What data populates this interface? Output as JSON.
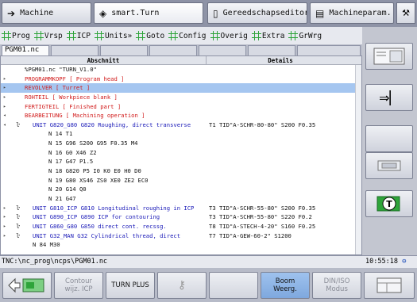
{
  "modes": [
    {
      "label": "Machine",
      "icon": "arrow-right-icon"
    },
    {
      "label": "smart.Turn",
      "icon": "diamond-arrow-icon",
      "active": true
    },
    {
      "label": "Gereedschapseditor",
      "icon": "tool-editor-icon"
    },
    {
      "label": "Machineparam.",
      "icon": "machine-param-icon"
    }
  ],
  "menu": [
    "Prog",
    "Vrsp",
    "ICP",
    "Units»",
    "Goto",
    "Config",
    "Overig",
    "Extra",
    "GrWrg"
  ],
  "file_tab": "PGM01.nc",
  "table": {
    "col_section": "Abschnitt",
    "col_details": "Details",
    "rows": [
      {
        "text": "%PGM01.nc  \"TURN_V1.0\"",
        "color": "black",
        "indent": 30
      },
      {
        "text": "PROGRAMMKOPF  [ Program head ]",
        "color": "red",
        "indent": 30,
        "exp": "▸"
      },
      {
        "text": "REVOLVER  [ Turret ]",
        "color": "red",
        "indent": 30,
        "exp": "▸",
        "sel": true
      },
      {
        "text": "ROHTEIL  [ Workpiece blank ]",
        "color": "red",
        "indent": 30,
        "exp": "▸"
      },
      {
        "text": "FERTIGTEIL  [ Finished part ]",
        "color": "red",
        "indent": 30,
        "exp": "▸"
      },
      {
        "text": "BEARBEITUNG  [ Machining operation ]",
        "color": "red",
        "indent": 30,
        "exp": "◂"
      },
      {
        "text": "UNIT G820_G80  G820 Roughing, direct transverse",
        "color": "blue",
        "indent": 40,
        "exp": "◂",
        "icon": "ŀ",
        "detail": "T1 TID\"A-SCHR-80-80\" S200 F0.35"
      },
      {
        "text": "N  14   T1",
        "color": "black",
        "indent": 60
      },
      {
        "text": "N  15   G96 S200 G95 F0.35 M4",
        "color": "black",
        "indent": 60
      },
      {
        "text": "N  16   G0 X46 Z2",
        "color": "black",
        "indent": 60
      },
      {
        "text": "N  17   G47 P1.5",
        "color": "black",
        "indent": 60
      },
      {
        "text": "N  18   G820 P5 I0 K0 E0 H0 D0",
        "color": "black",
        "indent": 60
      },
      {
        "text": "N  19   G80 XS46 ZS0 XE0 ZE2 EC0",
        "color": "black",
        "indent": 60
      },
      {
        "text": "N  20   G14 Q0",
        "color": "black",
        "indent": 60
      },
      {
        "text": "N  21   G47",
        "color": "black",
        "indent": 60
      },
      {
        "text": "UNIT G810_ICP  G810 Longitudinal roughing in ICP",
        "color": "blue",
        "indent": 40,
        "exp": "▸",
        "icon": "ŀ",
        "detail": "T3 TID\"A-SCHR-55-80\" S200 F0.35"
      },
      {
        "text": "UNIT G890_ICP  G890 ICP for contouring",
        "color": "blue",
        "indent": 40,
        "exp": "▸",
        "icon": "ŀ",
        "detail": "T3 TID\"A-SCHR-55-80\" S220 F0.2"
      },
      {
        "text": "UNIT G860_G80  G850 direct cont. recssg.",
        "color": "blue",
        "indent": 40,
        "exp": "▸",
        "icon": "ŀ",
        "detail": "T8 TID\"A-STECH-4-20\" S160 F0.25"
      },
      {
        "text": "UNIT G32_MAN  G32 Cylindrical thread, direct",
        "color": "blue",
        "indent": 40,
        "exp": "▸",
        "icon": "ŀ",
        "detail": "T7 TID\"A-GEW-60-2\" S1200"
      },
      {
        "text": "N  84 M30",
        "color": "black",
        "indent": 40
      }
    ]
  },
  "path": "TNC:\\nc_prog\\ncps\\PGM01.nc",
  "clock": "10:55:18",
  "softkeys": [
    {
      "label": "",
      "name": "icp-insert-softkey",
      "state": "normal"
    },
    {
      "label": "Contour\nwijz. ICP",
      "name": "contour-edit-icp-softkey",
      "state": "disabled"
    },
    {
      "label": "TURN PLUS",
      "name": "turn-plus-softkey",
      "state": "normal"
    },
    {
      "label": "",
      "name": "key-icon-softkey",
      "state": "disabled"
    },
    {
      "label": "",
      "name": "empty-softkey",
      "state": "normal"
    },
    {
      "label": "Boom\nWeerg.",
      "name": "tree-view-softkey",
      "state": "highlight"
    },
    {
      "label": "DIN/ISO\nModus",
      "name": "din-iso-mode-softkey",
      "state": "disabled"
    },
    {
      "label": "",
      "name": "screen-layout-softkey",
      "state": "normal"
    }
  ]
}
